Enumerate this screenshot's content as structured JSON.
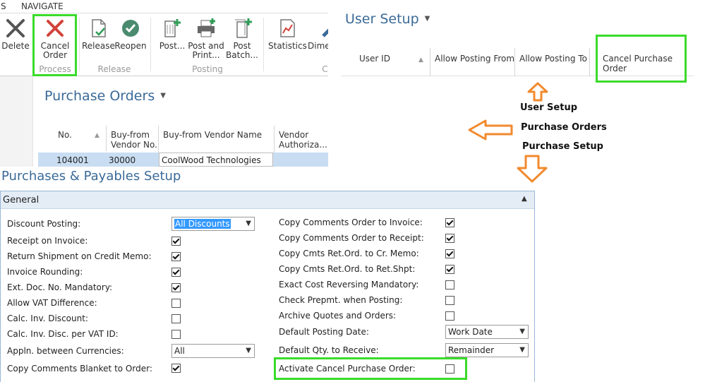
{
  "ribbon": {
    "tabs": [
      "S",
      "NAVIGATE"
    ],
    "buttons": {
      "delete": "Delete",
      "cancel_order": "Cancel\nOrder",
      "release": "Release",
      "reopen": "Reopen",
      "post": "Post...",
      "post_and_print": "Post and\nPrint...",
      "post_batch": "Post\nBatch...",
      "statistics": "Statistics",
      "dime": "Dime",
      "cut_c": "C"
    },
    "groups": {
      "process": "Process",
      "release": "Release",
      "posting": "Posting"
    }
  },
  "purchase_orders": {
    "title": "Purchase Orders",
    "columns": [
      "No.",
      "Buy-from\nVendor No.",
      "Buy-from Vendor Name",
      "Vendor\nAuthoriza..."
    ],
    "rows": [
      {
        "no": "104001",
        "vendor_no": "30000",
        "vendor_name": "CoolWood Technologies"
      }
    ]
  },
  "user_setup": {
    "title": "User Setup",
    "columns": [
      "User ID",
      "Allow Posting From",
      "Allow Posting To",
      "Cancel Purchase\nOrder"
    ]
  },
  "annotations": {
    "user_setup": "User Setup",
    "purchase_orders": "Purchase Orders",
    "purchase_setup": "Purchase Setup"
  },
  "setup": {
    "title": "Purchases & Payables Setup",
    "section": "General",
    "left": [
      {
        "label": "Discount Posting:",
        "type": "select",
        "value": "All Discounts"
      },
      {
        "label": "Receipt on Invoice:",
        "type": "checkbox",
        "checked": true
      },
      {
        "label": "Return Shipment on Credit Memo:",
        "type": "checkbox",
        "checked": true
      },
      {
        "label": "Invoice Rounding:",
        "type": "checkbox",
        "checked": true
      },
      {
        "label": "Ext. Doc. No. Mandatory:",
        "type": "checkbox",
        "checked": true
      },
      {
        "label": "Allow VAT Difference:",
        "type": "checkbox",
        "checked": false
      },
      {
        "label": "Calc. Inv. Discount:",
        "type": "checkbox",
        "checked": false
      },
      {
        "label": "Calc. Inv. Disc. per VAT ID:",
        "type": "checkbox",
        "checked": false
      },
      {
        "label": "Appln. between Currencies:",
        "type": "select",
        "value": "All"
      },
      {
        "label": "Copy Comments Blanket to Order:",
        "type": "checkbox",
        "checked": true
      }
    ],
    "right": [
      {
        "label": "Copy Comments Order to Invoice:",
        "type": "checkbox",
        "checked": true
      },
      {
        "label": "Copy Comments Order to Receipt:",
        "type": "checkbox",
        "checked": true
      },
      {
        "label": "Copy Cmts Ret.Ord. to Cr. Memo:",
        "type": "checkbox",
        "checked": true
      },
      {
        "label": "Copy Cmts Ret.Ord. to Ret.Shpt:",
        "type": "checkbox",
        "checked": true
      },
      {
        "label": "Exact Cost Reversing Mandatory:",
        "type": "checkbox",
        "checked": false
      },
      {
        "label": "Check Prepmt. when Posting:",
        "type": "checkbox",
        "checked": false
      },
      {
        "label": "Archive Quotes and Orders:",
        "type": "checkbox",
        "checked": false
      },
      {
        "label": "Default Posting Date:",
        "type": "select",
        "value": "Work Date"
      },
      {
        "label": "Default Qty. to Receive:",
        "type": "select",
        "value": "Remainder"
      },
      {
        "label": "Activate Cancel Purchase Order:",
        "type": "checkbox",
        "checked": false
      }
    ]
  },
  "colors": {
    "highlight": "#3adb2a",
    "arrow": "#f28a2e",
    "title_blue": "#3a6a97",
    "selected_row": "#c9ddf2"
  }
}
